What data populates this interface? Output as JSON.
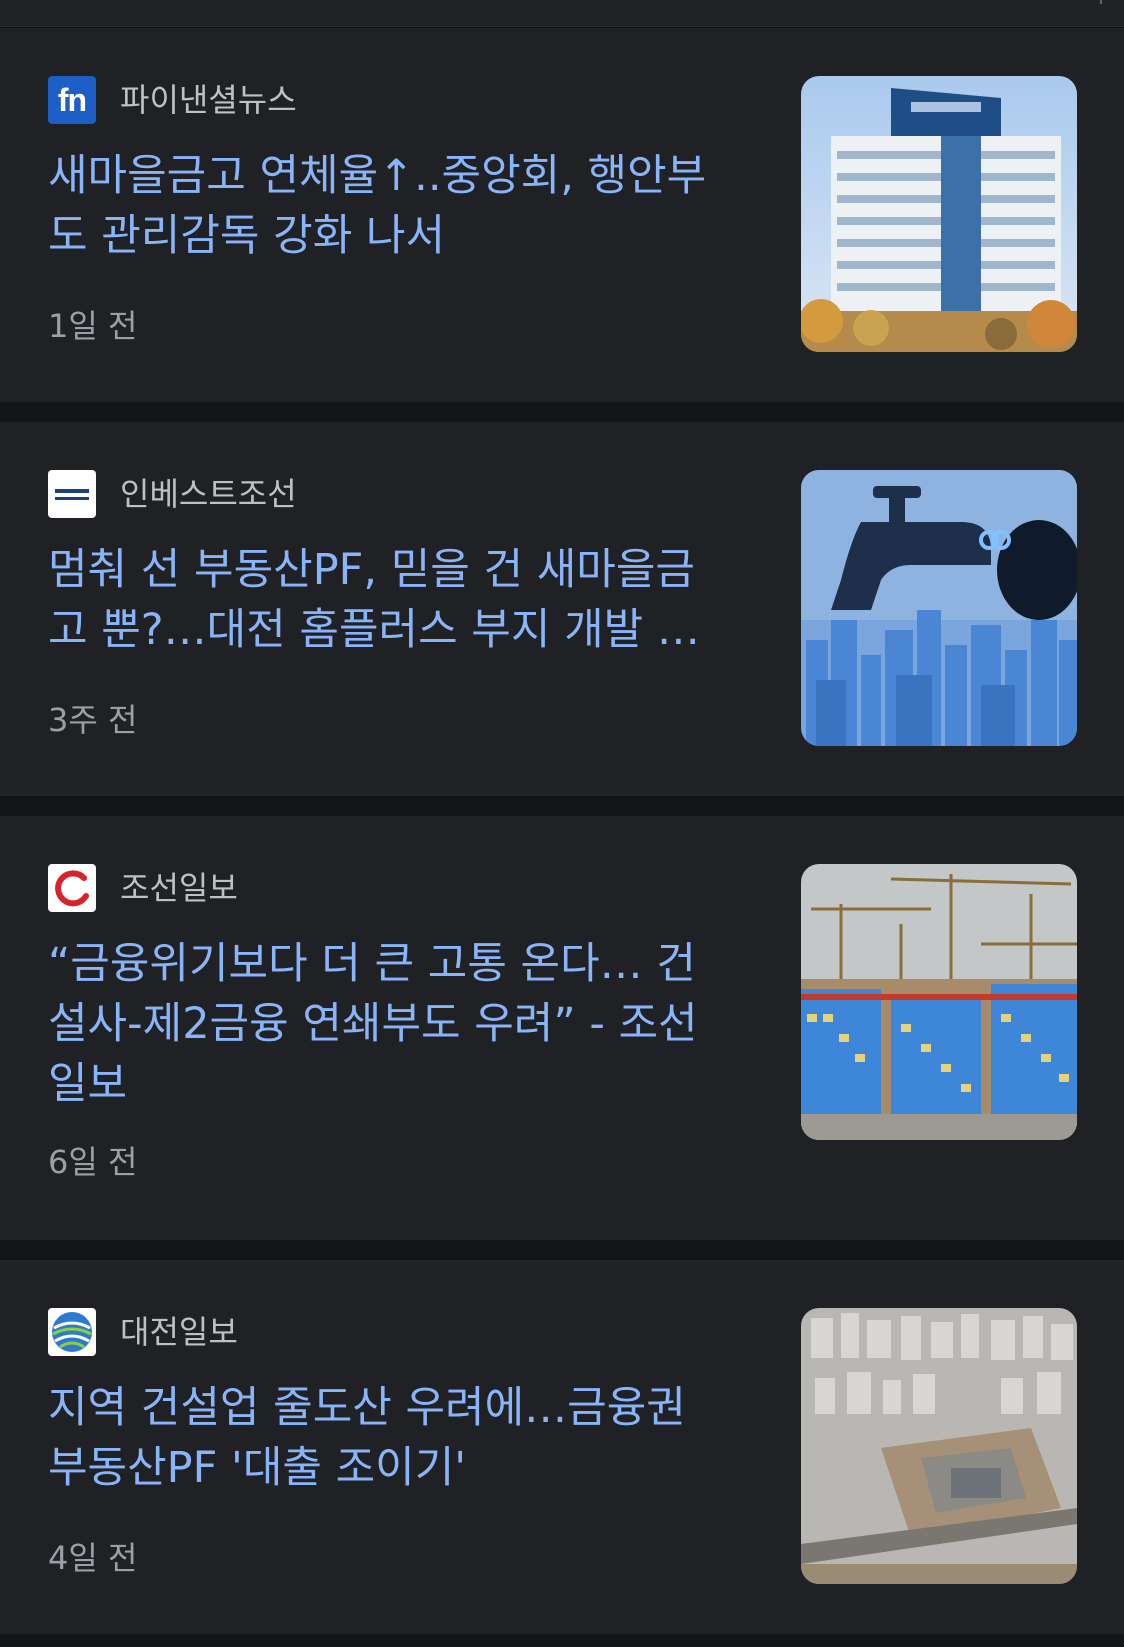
{
  "articles": [
    {
      "source": "파이낸셜뉴스",
      "logo_icon": "fn-logo-icon",
      "logo_text": "fn",
      "headline_line1": "새마을금고 연체율↑..중앙회, 행안부",
      "headline_line2": "도 관리감독 강화 나서",
      "headline_line3": "",
      "time": "1일 전",
      "thumbnail": "office-building-thumbnail"
    },
    {
      "source": "인베스트조선",
      "logo_icon": "investchosun-logo-icon",
      "headline_line1": "멈춰 선 부동산PF, 믿을 건 새마을금",
      "headline_line2": "고 뿐?…대전 홈플러스 부지 개발 …",
      "headline_line3": "",
      "time": "3주 전",
      "thumbnail": "faucet-city-thumbnail"
    },
    {
      "source": "조선일보",
      "logo_icon": "chosun-logo-icon",
      "headline_line1": "“금융위기보다 더 큰 고통 온다… 건",
      "headline_line2": "설사-제2금융 연쇄부도 우려” - 조선",
      "headline_line3": "일보",
      "time": "6일 전",
      "thumbnail": "construction-cranes-thumbnail"
    },
    {
      "source": "대전일보",
      "logo_icon": "daejeon-ilbo-logo-icon",
      "headline_line1": "지역 건설업 줄도산 우려에…금융권",
      "headline_line2": "부동산PF '대출 조이기'",
      "headline_line3": "",
      "time": "4일 전",
      "thumbnail": "aerial-city-thumbnail"
    }
  ],
  "colors": {
    "page_background": "#131416",
    "card_background": "#202124",
    "headline": "#8ab4f8",
    "source_text": "#bdc1c6",
    "time_text": "#9aa0a6"
  }
}
